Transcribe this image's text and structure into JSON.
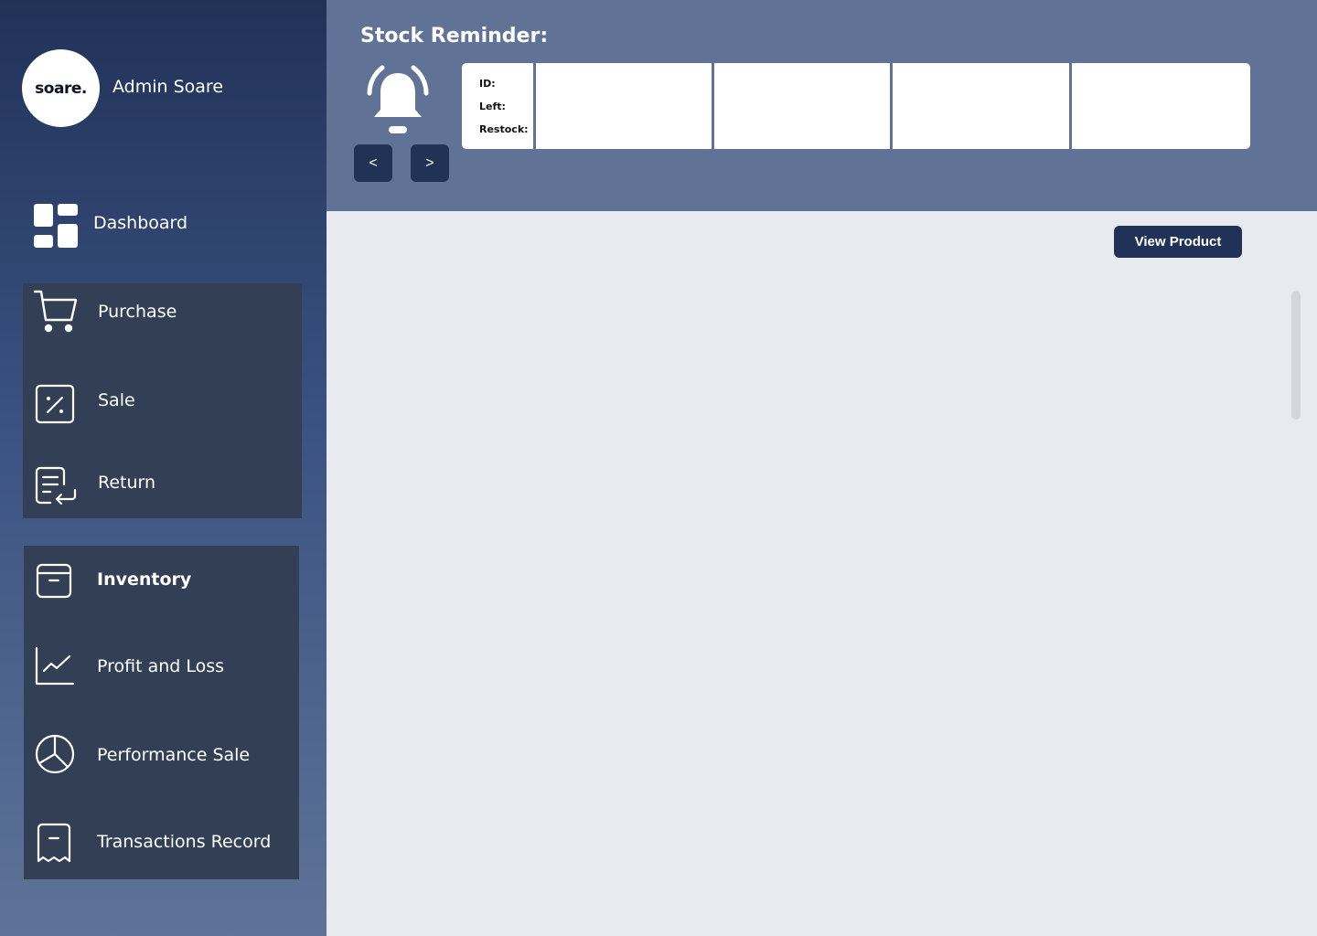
{
  "sidebar": {
    "logo_text": "soare.",
    "admin_name": "Admin Soare",
    "dashboard_label": "Dashboard",
    "group1": [
      {
        "label": "Purchase",
        "icon": "cart-icon"
      },
      {
        "label": "Sale",
        "icon": "percent-icon"
      },
      {
        "label": "Return",
        "icon": "return-receipt-icon"
      }
    ],
    "group2": [
      {
        "label": "Inventory",
        "icon": "box-icon",
        "active": true
      },
      {
        "label": "Profit and Loss",
        "icon": "line-chart-icon"
      },
      {
        "label": "Performance Sale",
        "icon": "pie-chart-icon"
      },
      {
        "label": "Transactions Record",
        "icon": "receipt-icon"
      }
    ]
  },
  "header": {
    "title": "Stock Reminder:",
    "prev_label": "<",
    "next_label": ">",
    "reminder_labels": {
      "id": "ID:",
      "left": "Left:",
      "restock": "Restock:"
    }
  },
  "main": {
    "view_product_label": "View Product"
  },
  "colors": {
    "sidebar_top": "#213257",
    "sidebar_bottom": "#5f7397",
    "nav_group_bg": "#333f55",
    "header_bg": "#607397",
    "button_bg": "#213257",
    "main_bg": "#e9eaef"
  }
}
